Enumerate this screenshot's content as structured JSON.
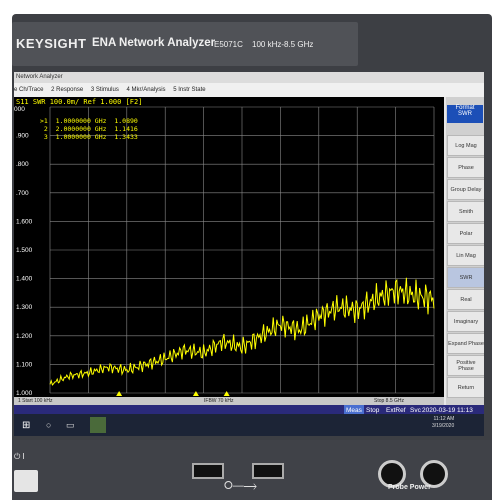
{
  "device": {
    "brand": "KEYSIGHT",
    "product": "ENA Network Analyzer",
    "model": "E5071C",
    "freq_range": "100 kHz-8.5 GHz"
  },
  "window": {
    "title": "Network Analyzer"
  },
  "menubar": {
    "items": [
      "e Ch/Trace",
      "2 Response",
      "3 Stimulus",
      "4 Mkr/Analysis",
      "5 Instr State"
    ]
  },
  "trace": {
    "header": "S11  SWR 100.0m/ Ref 1.000 [F2]",
    "ref_line": "000",
    "markers": [
      {
        "label": ">1",
        "freq": "1.0000000 GHz",
        "value": "1.0890"
      },
      {
        "label": " 2",
        "freq": "2.0000000 GHz",
        "value": "1.1416"
      },
      {
        "label": " 3",
        "freq": "1.0000000 GHz",
        "value": "1.3433"
      }
    ]
  },
  "chart_data": {
    "type": "line",
    "ylabel_ticks": [
      ".900",
      ".800",
      ".700",
      "1.600",
      "1.500",
      "1.400",
      "1.300",
      "1.200",
      "1.100",
      "1.000"
    ],
    "ylim": [
      1.0,
      2.0
    ],
    "grid": true,
    "series": [
      {
        "color": "#ffff00",
        "x": [
          0,
          1,
          2,
          3,
          4,
          5,
          6,
          7,
          8,
          9,
          10,
          11,
          12,
          13,
          14,
          15,
          16,
          17,
          18,
          19,
          20
        ],
        "values": [
          1.03,
          1.06,
          1.07,
          1.09,
          1.08,
          1.1,
          1.12,
          1.15,
          1.14,
          1.18,
          1.16,
          1.2,
          1.24,
          1.22,
          1.27,
          1.3,
          1.29,
          1.33,
          1.36,
          1.34,
          1.33
        ]
      }
    ],
    "footer_start": "1  Start 100 kHz",
    "footer_ifbw": "IFBW 70 kHz",
    "footer_stop": "Stop 8.5 GHz"
  },
  "softkeys": {
    "header": "Format",
    "header_sub": "SWR",
    "items": [
      "Log Mag",
      "Phase",
      "Group Delay",
      "Smith",
      "Polar",
      "Lin Mag",
      "SWR",
      "Real",
      "Imaginary",
      "Expand Phase",
      "Positive Phase",
      "Return"
    ]
  },
  "statusbar": {
    "meas": "Meas",
    "stop": "Stop",
    "extref": "ExtRef",
    "svc": "Svc",
    "datetime": "2020-03-19 11:13"
  },
  "taskbar": {
    "time": "11:12 AM",
    "date": "3/19/2020"
  },
  "colors": {
    "trace": "#ffff00",
    "background": "#000000",
    "softkey_header": "#1c4fb7"
  }
}
